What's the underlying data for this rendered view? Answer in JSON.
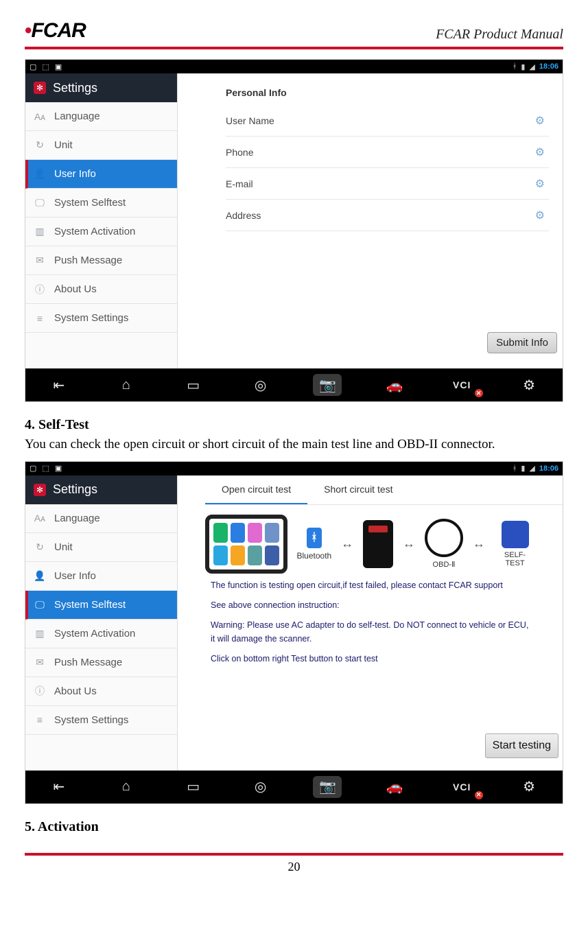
{
  "doc": {
    "logo_text": "FCAR",
    "manual_title": "FCAR Product Manual",
    "page_number": "20",
    "section4_h": "4. Self-Test",
    "section4_p": "You can check the open circuit or short circuit of the main test line and OBD-II connector.",
    "section5_h": "5. Activation"
  },
  "status": {
    "time": "18:06",
    "left_icons": [
      "▢",
      "⬚",
      "▣"
    ],
    "right_icons": [
      "ᚼ",
      "▮",
      "◢"
    ]
  },
  "header_title": "Settings",
  "sidebar": [
    {
      "icon": "Aᴀ",
      "label": "Language"
    },
    {
      "icon": "↻",
      "label": "Unit"
    },
    {
      "icon": "👤",
      "label": "User Info"
    },
    {
      "icon": "🖵",
      "label": "System Selftest"
    },
    {
      "icon": "▥",
      "label": "System Activation"
    },
    {
      "icon": "✉",
      "label": "Push Message"
    },
    {
      "icon": "ⓘ",
      "label": "About Us"
    },
    {
      "icon": "≡",
      "label": "System Settings"
    }
  ],
  "shot1": {
    "active_index": 2,
    "panel_title": "Personal Info",
    "rows": [
      "User Name",
      "Phone",
      "E-mail",
      "Address"
    ],
    "submit_label": "Submit Info"
  },
  "shot2": {
    "active_index": 3,
    "tabs": [
      "Open circuit test",
      "Short circuit test"
    ],
    "tab_selected": 0,
    "diagram": {
      "bluetooth": "Bluetooth",
      "obd": "OBD-Ⅱ",
      "self": "SELF-TEST"
    },
    "desc1": "The function is testing open circuit,if test failed, please contact FCAR support",
    "desc2": "See above connection instruction:",
    "desc3": "Warning: Please use AC adapter to do self-test. Do NOT connect to vehicle or ECU, it will damage the scanner.",
    "desc4": "Click on bottom right Test button to start test",
    "start_label": "Start testing"
  },
  "navbar": [
    "⇤",
    "⌂",
    "▭",
    "◎",
    "📷",
    "🚗",
    "VCI",
    "⚙"
  ]
}
